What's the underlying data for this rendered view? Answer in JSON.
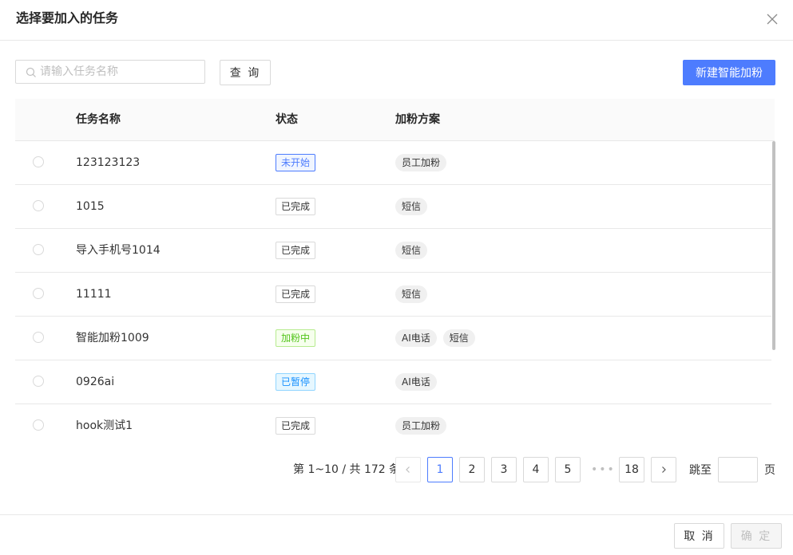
{
  "dialog": {
    "title": "选择要加入的任务",
    "close_icon": "close-icon"
  },
  "toolbar": {
    "search_placeholder": "请输入任务名称",
    "search_value": "",
    "query_label": "查 询",
    "new_label": "新建智能加粉"
  },
  "table": {
    "columns": [
      "任务名称",
      "状态",
      "加粉方案"
    ],
    "rows": [
      {
        "name": "123123123",
        "status": "未开始",
        "plans": [
          "员工加粉"
        ]
      },
      {
        "name": "1015",
        "status": "已完成",
        "plans": [
          "短信"
        ]
      },
      {
        "name": "导入手机号1014",
        "status": "已完成",
        "plans": [
          "短信"
        ]
      },
      {
        "name": "11111",
        "status": "已完成",
        "plans": [
          "短信"
        ]
      },
      {
        "name": "智能加粉1009",
        "status": "加粉中",
        "plans": [
          "AI电话",
          "短信"
        ]
      },
      {
        "name": "0926ai",
        "status": "已暂停",
        "plans": [
          "AI电话"
        ]
      },
      {
        "name": "hook测试1",
        "status": "已完成",
        "plans": [
          "员工加粉"
        ]
      }
    ]
  },
  "status_colors": {
    "未开始": {
      "text": "#4d7cfe",
      "bg": "#f0f5ff",
      "border": "#4d7cfe"
    },
    "已完成": {
      "text": "#333333",
      "bg": "#ffffff",
      "border": "#d9d9d9"
    },
    "加粉中": {
      "text": "#52c41a",
      "bg": "#f6ffed",
      "border": "#b7eb8f"
    },
    "已暂停": {
      "text": "#1890ff",
      "bg": "#e6f7ff",
      "border": "#91d5ff"
    }
  },
  "pagination": {
    "total_text": "第 1~10 / 共 172 条",
    "prev_icon": "chevron-left-icon",
    "pages": [
      "1",
      "2",
      "3",
      "4",
      "5"
    ],
    "current": "1",
    "ellipsis": "•••",
    "last_page": "18",
    "next_icon": "chevron-right-icon",
    "jump_label": "跳至",
    "jump_value": "",
    "jump_suffix": "页"
  },
  "footer": {
    "cancel_label": "取 消",
    "ok_label": "确 定"
  },
  "colors": {
    "primary": "#4d7cfe"
  }
}
